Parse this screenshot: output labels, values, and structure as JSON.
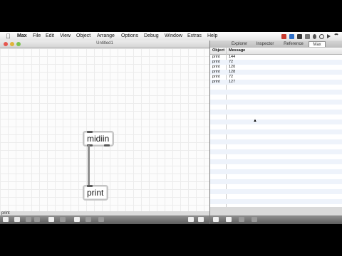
{
  "menubar": {
    "app_name": "Max",
    "items": [
      "File",
      "Edit",
      "View",
      "Object",
      "Arrange",
      "Options",
      "Debug",
      "Window",
      "Extras",
      "Help"
    ]
  },
  "patcher": {
    "title": "Untitled1",
    "objects": [
      {
        "name": "midiin-object",
        "label": "midiin"
      },
      {
        "name": "print-object",
        "label": "print"
      }
    ],
    "status_text": "print"
  },
  "sidebar": {
    "tabs": [
      "Explorer",
      "Inspector",
      "Reference",
      "Max"
    ],
    "active_tab": "Max",
    "columns": [
      "Object",
      "Message"
    ],
    "rows": [
      {
        "object": "print",
        "message": "144"
      },
      {
        "object": "print",
        "message": "72"
      },
      {
        "object": "print",
        "message": "120"
      },
      {
        "object": "print",
        "message": "128"
      },
      {
        "object": "print",
        "message": "72"
      },
      {
        "object": "print",
        "message": "127"
      }
    ]
  },
  "colors": {
    "red": "#e6574f",
    "yellow": "#e0b43a",
    "green": "#7bc24d",
    "cord": "#8f8f8f"
  }
}
